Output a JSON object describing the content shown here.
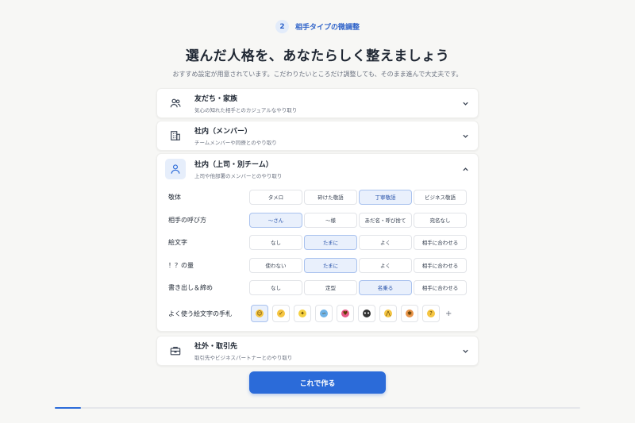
{
  "step": {
    "number": "2",
    "label": "相手タイプの微調整"
  },
  "title": "選んだ人格を、あなたらしく整えましょう",
  "subtitle": "おすすめ設定が用意されています。こだわりたいところだけ調整しても、そのまま進んで大丈夫です。",
  "cards": [
    {
      "title": "友だち・家族",
      "desc": "気心の知れた相手とのカジュアルなやり取り",
      "icon": "people-icon",
      "expanded": false
    },
    {
      "title": "社内（メンバー）",
      "desc": "チームメンバーや同僚とのやり取り",
      "icon": "building-icon",
      "expanded": false
    },
    {
      "title": "社内（上司・別チーム）",
      "desc": "上司や他部署のメンバーとのやり取り",
      "icon": "person-icon",
      "expanded": true
    },
    {
      "title": "社外・取引先",
      "desc": "取引先やビジネスパートナーとのやり取り",
      "icon": "briefcase-icon",
      "expanded": false
    }
  ],
  "settings": [
    {
      "label": "敬体",
      "options": [
        "タメロ",
        "砕けた敬語",
        "丁寧敬語",
        "ビジネス敬語"
      ],
      "selected": 2
    },
    {
      "label": "相手の呼び方",
      "options": [
        "〜さん",
        "〜様",
        "あだ名・呼び捨て",
        "宛名なし"
      ],
      "selected": 0
    },
    {
      "label": "絵文字",
      "options": [
        "なし",
        "たまに",
        "よく",
        "相手に合わせる"
      ],
      "selected": 1
    },
    {
      "label": "！？の量",
      "options": [
        "使わない",
        "たまに",
        "よく",
        "相手に合わせる"
      ],
      "selected": 1
    },
    {
      "label": "書き出し＆締め",
      "options": [
        "なし",
        "定型",
        "名乗る",
        "相手に合わせる"
      ],
      "selected": 2
    }
  ],
  "emoji_label": "よく使う絵文字の手札",
  "emojis": [
    {
      "name": "smile-emoji-icon",
      "color": "#f5c542",
      "glyph": "☺"
    },
    {
      "name": "thumbs-up-emoji-icon",
      "color": "#f5c542",
      "glyph": "✓"
    },
    {
      "name": "sparkles-emoji-icon",
      "color": "#f5d142",
      "glyph": "✦"
    },
    {
      "name": "sweat-emoji-icon",
      "color": "#6fb3e8",
      "glyph": "∽"
    },
    {
      "name": "heart-emoji-icon",
      "color": "#e85a8a",
      "glyph": "♥"
    },
    {
      "name": "eyes-emoji-icon",
      "color": "#333333",
      "glyph": "••"
    },
    {
      "name": "pray-emoji-icon",
      "color": "#f5c542",
      "glyph": "⋀"
    },
    {
      "name": "party-emoji-icon",
      "color": "#e8944a",
      "glyph": "✱"
    },
    {
      "name": "thinking-emoji-icon",
      "color": "#f5c542",
      "glyph": "?"
    }
  ],
  "emoji_selected": 0,
  "emoji_add": "+",
  "cta": "これで作る",
  "progress": 0.05,
  "colors": {
    "accent": "#2b6bd9",
    "selected_bg": "#e9f0fc"
  }
}
